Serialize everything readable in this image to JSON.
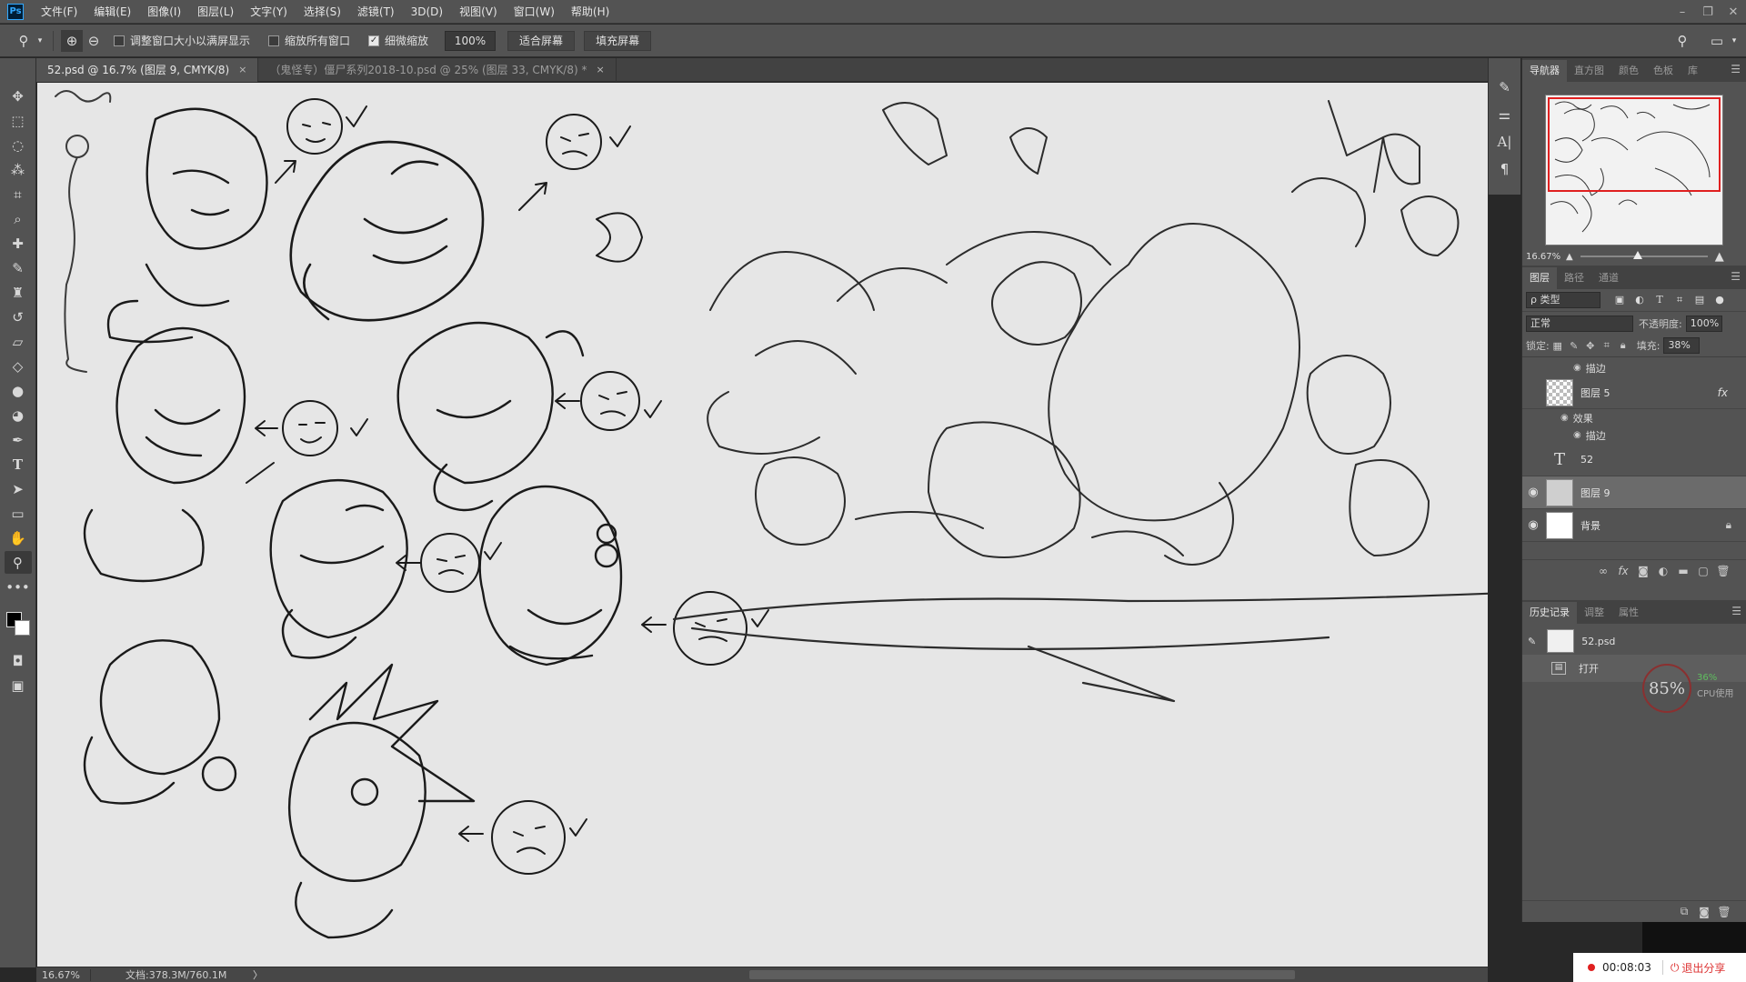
{
  "app": {
    "logo": "Ps"
  },
  "menu": [
    "文件(F)",
    "编辑(E)",
    "图像(I)",
    "图层(L)",
    "文字(Y)",
    "选择(S)",
    "滤镜(T)",
    "3D(D)",
    "视图(V)",
    "窗口(W)",
    "帮助(H)"
  ],
  "options": {
    "resize_windows": "调整窗口大小以满屏显示",
    "zoom_all": "缩放所有窗口",
    "scrubby_zoom": "细微缩放",
    "zoom_value": "100%",
    "fit_screen": "适合屏幕",
    "fill_screen": "填充屏幕"
  },
  "tabs": [
    {
      "label": "52.psd @ 16.7% (图层 9, CMYK/8)",
      "close": "×"
    },
    {
      "label": "（鬼怪专）僵尸系列2018-10.psd @ 25% (图层 33, CMYK/8) *",
      "close": "×"
    }
  ],
  "status": {
    "zoom": "16.67%",
    "doc": "文档:378.3M/760.1M",
    "arrow": "〉"
  },
  "navigator": {
    "tabs": [
      "导航器",
      "直方图",
      "颜色",
      "色板",
      "库"
    ],
    "zoom": "16.67%"
  },
  "layers": {
    "tabs": [
      "图层",
      "路径",
      "通道"
    ],
    "filter": "ρ 类型",
    "blend_mode": "正常",
    "opacity_label": "不透明度:",
    "opacity": "100%",
    "lock_label": "锁定:",
    "fill_label": "填充:",
    "fill": "38%",
    "stroke_label": "描边",
    "effects_label": "效果",
    "stroke_label_2": "描边",
    "items": [
      {
        "name": "图层 5",
        "fx": "fx"
      },
      {
        "name": "52"
      },
      {
        "name": "图层 9"
      },
      {
        "name": "背景"
      }
    ]
  },
  "history": {
    "tabs": [
      "历史记录",
      "调整",
      "属性"
    ],
    "snapshot": "52.psd",
    "step": "打开"
  },
  "cpu": {
    "value": "85%",
    "small": "36%",
    "label": "CPU使用"
  },
  "recording": {
    "time": "00:08:03",
    "quit": "退出分享"
  }
}
